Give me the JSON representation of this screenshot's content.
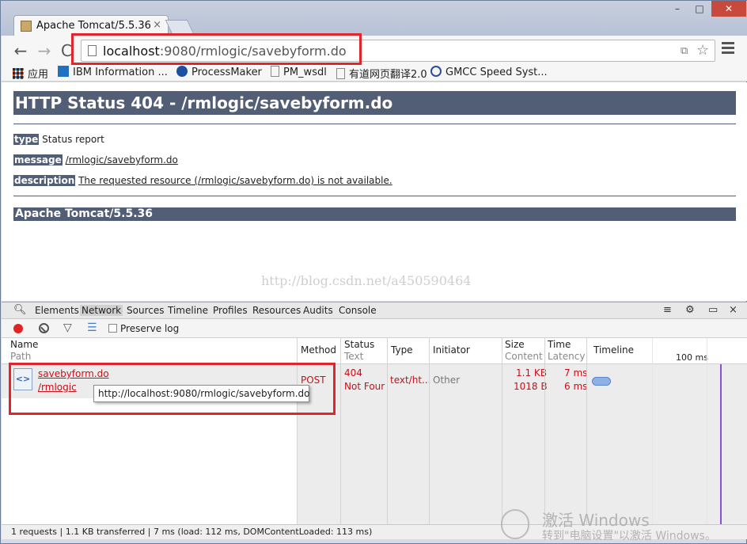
{
  "window": {
    "tab_title": "Apache Tomcat/5.5.36",
    "tab_close": "×",
    "minimize": "–",
    "maximize": "□",
    "close": "✕"
  },
  "toolbar": {
    "back": "←",
    "forward": "→",
    "reload": "C",
    "url_host": "localhost",
    "url_rest": ":9080/rmlogic/savebyform.do",
    "translate_icon": "⧉",
    "star_icon": "☆"
  },
  "bookmarks": [
    {
      "label": "应用",
      "icon": "apps-icon",
      "color": "#d24726"
    },
    {
      "label": "IBM Information ...",
      "icon": "ibm-icon",
      "color": "#1f70c1"
    },
    {
      "label": "ProcessMaker",
      "icon": "processmaker-icon",
      "color": "#1e4fa0"
    },
    {
      "label": "PM_wsdl",
      "icon": "page-icon",
      "color": "#888888"
    },
    {
      "label": "有道网页翻译2.0",
      "icon": "page-icon",
      "color": "#888888"
    },
    {
      "label": "GMCC Speed Syst...",
      "icon": "gmcc-icon",
      "color": "#2b4c9b"
    }
  ],
  "page": {
    "heading": "HTTP Status 404 - /rmlogic/savebyform.do",
    "type_label": "type",
    "type_value": "Status report",
    "message_label": "message",
    "message_value": "/rmlogic/savebyform.do",
    "description_label": "description",
    "description_value": "The requested resource (/rmlogic/savebyform.do) is not available.",
    "footer": "Apache Tomcat/5.5.36",
    "watermark": "http://blog.csdn.net/a450590464"
  },
  "devtools": {
    "tabs": [
      "Elements",
      "Network",
      "Sources",
      "Timeline",
      "Profiles",
      "Resources",
      "Audits",
      "Console"
    ],
    "active_tab": "Network",
    "preserve_log": "Preserve log",
    "columns": {
      "name": "Name",
      "name_sub": "Path",
      "method": "Method",
      "status": "Status",
      "status_sub": "Text",
      "type": "Type",
      "initiator": "Initiator",
      "size": "Size",
      "size_sub": "Content",
      "time": "Time",
      "time_sub": "Latency",
      "timeline": "Timeline",
      "timeline_mark": "100 ms"
    },
    "request": {
      "name": "savebyform.do",
      "path": "/rmlogic",
      "method": "POST",
      "status": "404",
      "status_text": "Not Four",
      "type": "text/ht...",
      "initiator": "Other",
      "size": "1.1 KB",
      "content": "1018 B",
      "time": "7 ms",
      "latency": "6 ms",
      "tooltip": "http://localhost:9080/rmlogic/savebyform.do"
    },
    "status_bar": "1 requests | 1.1 KB transferred | 7 ms (load: 112 ms, DOMContentLoaded: 113 ms)"
  },
  "activation": {
    "title": "激活 Windows",
    "subtitle": "转到\"电脑设置\"以激活 Windows。"
  },
  "colors": {
    "tomcat_header": "#525d76",
    "highlight": "#e0262a",
    "error_red": "#c8101a"
  }
}
